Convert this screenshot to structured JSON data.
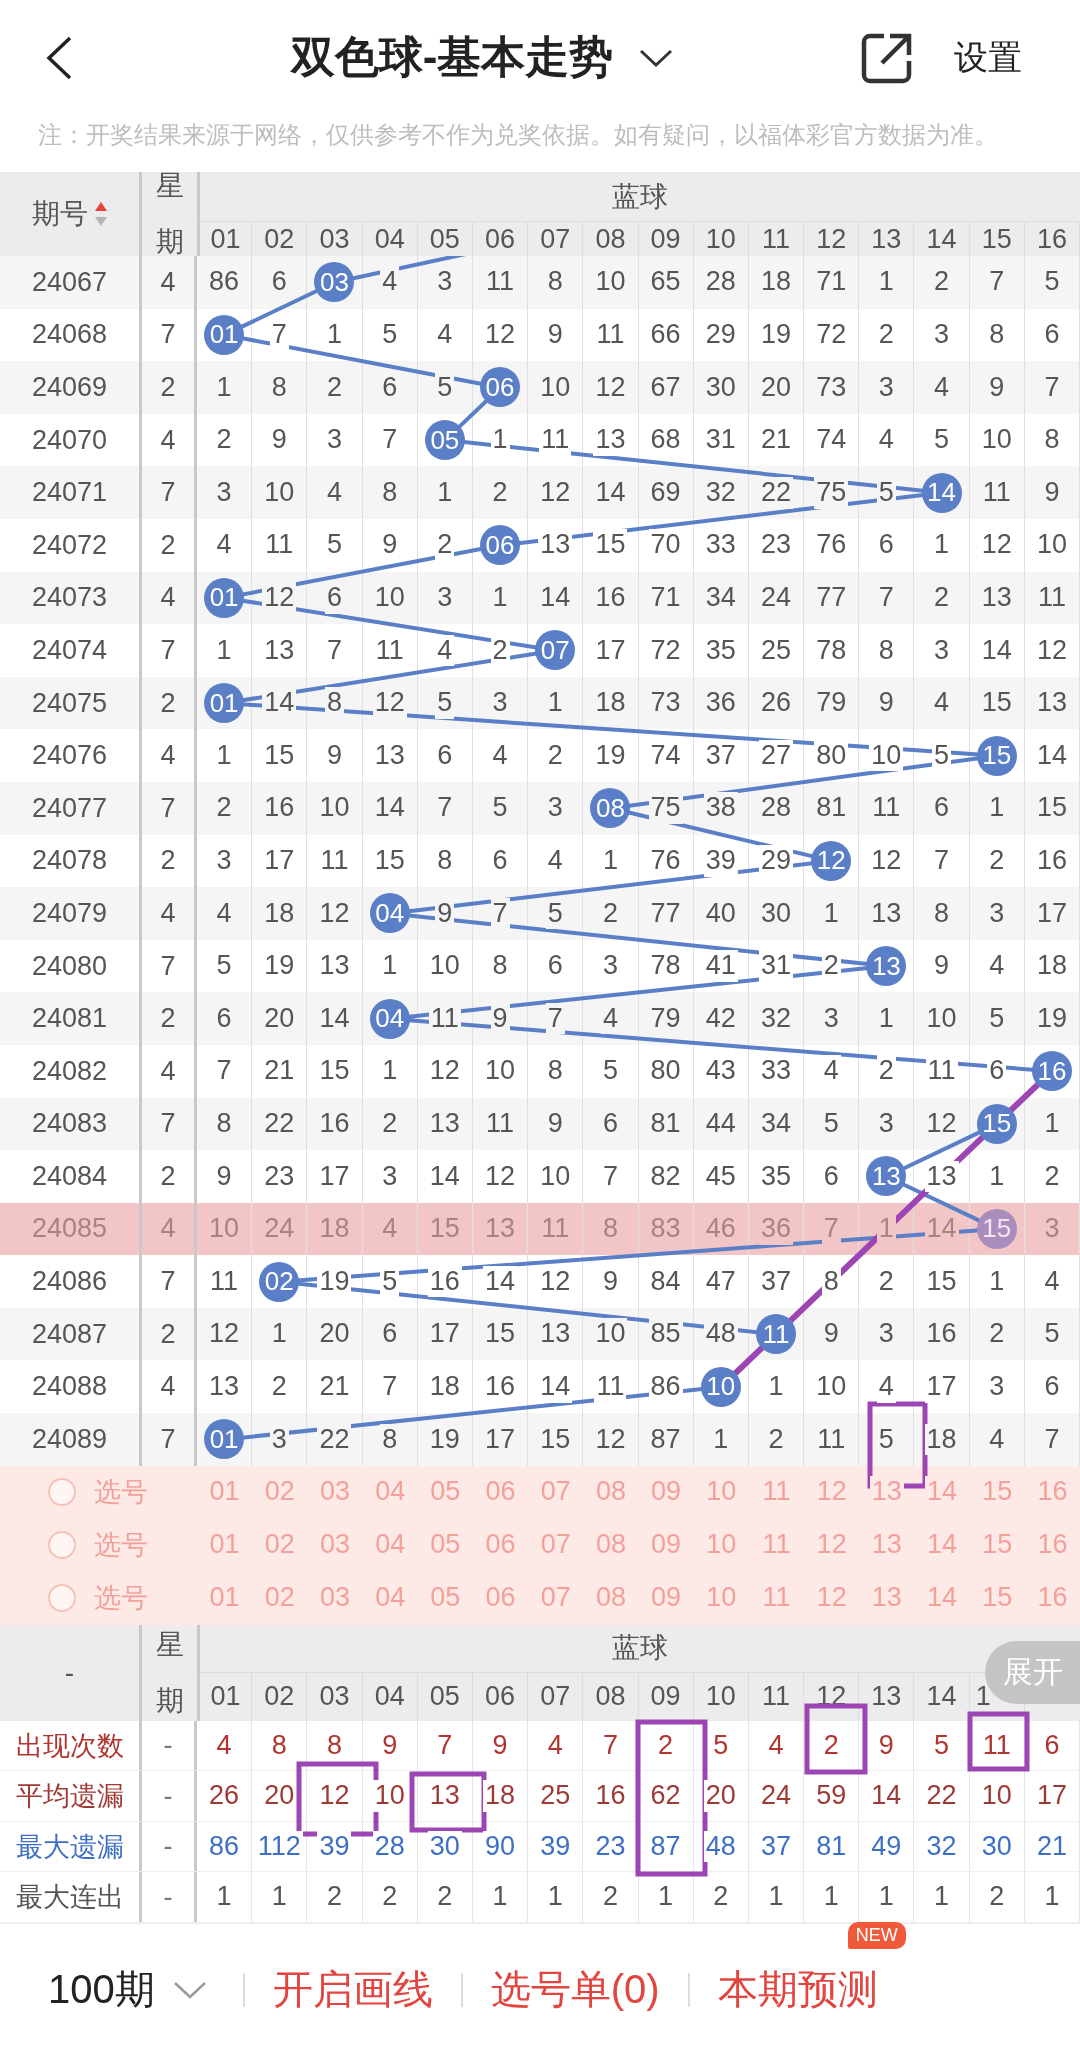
{
  "top_bar": {
    "title": "双色球-基本走势",
    "settings": "设置"
  },
  "note": "注：开奖结果来源于网络，仅供参考不作为兑奖依据。如有疑问，以福体彩官方数据为准。",
  "header": {
    "period_label": "期号",
    "sort_ascending": true,
    "weekday_label": "星期",
    "group_label": "蓝球",
    "columns": [
      "01",
      "02",
      "03",
      "04",
      "05",
      "06",
      "07",
      "08",
      "09",
      "10",
      "11",
      "12",
      "13",
      "14",
      "15",
      "16"
    ]
  },
  "rows": [
    {
      "period": "24067",
      "weekday": "4",
      "selected": false,
      "before": [
        "86",
        "6"
      ],
      "ball": "03",
      "after": [
        "4",
        "3",
        "11",
        "8",
        "10",
        "65",
        "28",
        "18",
        "71",
        "1",
        "2",
        "7",
        "5"
      ]
    },
    {
      "period": "24068",
      "weekday": "7",
      "selected": false,
      "ball": "01",
      "after": [
        "7",
        "1",
        "5",
        "4",
        "12",
        "9",
        "11",
        "66",
        "29",
        "19",
        "72",
        "2",
        "3",
        "8",
        "6"
      ]
    },
    {
      "period": "24069",
      "weekday": "2",
      "selected": false,
      "before": [
        "1",
        "8",
        "2",
        "6",
        "5"
      ],
      "ball": "06",
      "after": [
        "10",
        "12",
        "67",
        "30",
        "20",
        "73",
        "3",
        "4",
        "9",
        "7"
      ]
    },
    {
      "period": "24070",
      "weekday": "4",
      "selected": false,
      "before": [
        "2",
        "9",
        "3",
        "7"
      ],
      "ball": "05",
      "after": [
        "1",
        "11",
        "13",
        "68",
        "31",
        "21",
        "74",
        "4",
        "5",
        "10",
        "8"
      ]
    },
    {
      "period": "24071",
      "weekday": "7",
      "selected": false,
      "before": [
        "3",
        "10",
        "4",
        "8",
        "1",
        "2",
        "12",
        "14",
        "69",
        "32",
        "22",
        "75",
        "5"
      ],
      "ball": "14",
      "after": [
        "11",
        "9"
      ]
    },
    {
      "period": "24072",
      "weekday": "2",
      "selected": false,
      "before": [
        "4",
        "11",
        "5",
        "9",
        "2"
      ],
      "ball": "06",
      "after": [
        "13",
        "15",
        "70",
        "33",
        "23",
        "76",
        "6",
        "1",
        "12",
        "10"
      ]
    },
    {
      "period": "24073",
      "weekday": "4",
      "selected": false,
      "ball": "01",
      "after": [
        "12",
        "6",
        "10",
        "3",
        "1",
        "14",
        "16",
        "71",
        "34",
        "24",
        "77",
        "7",
        "2",
        "13",
        "11"
      ]
    },
    {
      "period": "24074",
      "weekday": "7",
      "selected": false,
      "before": [
        "1",
        "13",
        "7",
        "11",
        "4",
        "2"
      ],
      "ball": "07",
      "after": [
        "17",
        "72",
        "35",
        "25",
        "78",
        "8",
        "3",
        "14",
        "12"
      ]
    },
    {
      "period": "24075",
      "weekday": "2",
      "selected": false,
      "ball": "01",
      "after": [
        "14",
        "8",
        "12",
        "5",
        "3",
        "1",
        "18",
        "73",
        "36",
        "26",
        "79",
        "9",
        "4",
        "15",
        "13"
      ]
    },
    {
      "period": "24076",
      "weekday": "4",
      "selected": false,
      "before": [
        "1",
        "15",
        "9",
        "13",
        "6",
        "4",
        "2",
        "19",
        "74",
        "37",
        "27",
        "80",
        "10",
        "5"
      ],
      "ball": "15",
      "after": [
        "14"
      ]
    },
    {
      "period": "24077",
      "weekday": "7",
      "selected": false,
      "before": [
        "2",
        "16",
        "10",
        "14",
        "7",
        "5",
        "3"
      ],
      "ball": "08",
      "after": [
        "75",
        "38",
        "28",
        "81",
        "11",
        "6",
        "1",
        "15"
      ]
    },
    {
      "period": "24078",
      "weekday": "2",
      "selected": false,
      "before": [
        "3",
        "17",
        "11",
        "15",
        "8",
        "6",
        "4",
        "1",
        "76",
        "39",
        "29"
      ],
      "ball": "12",
      "after": [
        "12",
        "7",
        "2",
        "16"
      ]
    },
    {
      "period": "24079",
      "weekday": "4",
      "selected": false,
      "before": [
        "4",
        "18",
        "12"
      ],
      "ball": "04",
      "after": [
        "9",
        "7",
        "5",
        "2",
        "77",
        "40",
        "30",
        "1",
        "13",
        "8",
        "3",
        "17"
      ]
    },
    {
      "period": "24080",
      "weekday": "7",
      "selected": false,
      "before": [
        "5",
        "19",
        "13",
        "1",
        "10",
        "8",
        "6",
        "3",
        "78",
        "41",
        "31",
        "2"
      ],
      "ball": "13",
      "after": [
        "9",
        "4",
        "18"
      ]
    },
    {
      "period": "24081",
      "weekday": "2",
      "selected": false,
      "before": [
        "6",
        "20",
        "14"
      ],
      "ball": "04",
      "after": [
        "11",
        "9",
        "7",
        "4",
        "79",
        "42",
        "32",
        "3",
        "1",
        "10",
        "5",
        "19"
      ]
    },
    {
      "period": "24082",
      "weekday": "4",
      "selected": false,
      "before": [
        "7",
        "21",
        "15",
        "1",
        "12",
        "10",
        "8",
        "5",
        "80",
        "43",
        "33",
        "4",
        "2",
        "11",
        "6"
      ],
      "ball": "16"
    },
    {
      "period": "24083",
      "weekday": "7",
      "selected": false,
      "before": [
        "8",
        "22",
        "16",
        "2",
        "13",
        "11",
        "9",
        "6",
        "81",
        "44",
        "34",
        "5",
        "3",
        "12"
      ],
      "ball": "15",
      "after": [
        "1"
      ]
    },
    {
      "period": "24084",
      "weekday": "2",
      "selected": false,
      "before": [
        "9",
        "23",
        "17",
        "3",
        "14",
        "12",
        "10",
        "7",
        "82",
        "45",
        "35",
        "6"
      ],
      "ball": "13",
      "after": [
        "13",
        "1",
        "2"
      ]
    },
    {
      "period": "24085",
      "weekday": "4",
      "selected": true,
      "before": [
        "10",
        "24",
        "18",
        "4",
        "15",
        "13",
        "11",
        "8",
        "83",
        "46",
        "36",
        "7",
        "1",
        "14"
      ],
      "ball": "15",
      "after": [
        "3"
      ]
    },
    {
      "period": "24086",
      "weekday": "7",
      "selected": false,
      "before": [
        "11"
      ],
      "ball": "02",
      "after": [
        "19",
        "5",
        "16",
        "14",
        "12",
        "9",
        "84",
        "47",
        "37",
        "8",
        "2",
        "15",
        "1",
        "4"
      ]
    },
    {
      "period": "24087",
      "weekday": "2",
      "selected": false,
      "before": [
        "12",
        "1",
        "20",
        "6",
        "17",
        "15",
        "13",
        "10",
        "85",
        "48"
      ],
      "ball": "11",
      "after": [
        "9",
        "3",
        "16",
        "2",
        "5"
      ]
    },
    {
      "period": "24088",
      "weekday": "4",
      "selected": false,
      "before": [
        "13",
        "2",
        "21",
        "7",
        "18",
        "16",
        "14",
        "11",
        "86"
      ],
      "ball": "10",
      "after": [
        "1",
        "10",
        "4",
        "17",
        "3",
        "6"
      ]
    },
    {
      "period": "24089",
      "weekday": "7",
      "selected": false,
      "ball": "01",
      "after": [
        "3",
        "22",
        "8",
        "19",
        "17",
        "15",
        "12",
        "87",
        "1",
        "2",
        "11",
        "5",
        "18",
        "4",
        "7"
      ]
    }
  ],
  "pick_rows": [
    {
      "label": "选号",
      "checked": false,
      "numbers": [
        "01",
        "02",
        "03",
        "04",
        "05",
        "06",
        "07",
        "08",
        "09",
        "10",
        "11",
        "12",
        "13",
        "14",
        "15",
        "16"
      ]
    },
    {
      "label": "选号",
      "checked": false,
      "numbers": [
        "01",
        "02",
        "03",
        "04",
        "05",
        "06",
        "07",
        "08",
        "09",
        "10",
        "11",
        "12",
        "13",
        "14",
        "15",
        "16"
      ]
    },
    {
      "label": "选号",
      "checked": false,
      "numbers": [
        "01",
        "02",
        "03",
        "04",
        "05",
        "06",
        "07",
        "08",
        "09",
        "10",
        "11",
        "12",
        "13",
        "14",
        "15",
        "16"
      ]
    }
  ],
  "stats_header": {
    "period_label": "-",
    "weekday_label": "星期",
    "group_label": "蓝球",
    "columns": [
      "01",
      "02",
      "03",
      "04",
      "05",
      "06",
      "07",
      "08",
      "09",
      "10",
      "11",
      "12",
      "13",
      "14",
      "1"
    ],
    "expand": "展开"
  },
  "stats": [
    {
      "kind": "count",
      "label": "出现次数",
      "weekday": "-",
      "values": [
        "4",
        "8",
        "8",
        "9",
        "7",
        "9",
        "4",
        "7",
        "2",
        "5",
        "4",
        "2",
        "9",
        "5",
        "11",
        "6"
      ]
    },
    {
      "kind": "average_miss",
      "label": "平均遗漏",
      "weekday": "-",
      "values": [
        "26",
        "20",
        "12",
        "10",
        "13",
        "18",
        "25",
        "16",
        "62",
        "20",
        "24",
        "59",
        "14",
        "22",
        "10",
        "17"
      ]
    },
    {
      "kind": "max_miss",
      "label": "最大遗漏",
      "weekday": "-",
      "values": [
        "86",
        "112",
        "39",
        "28",
        "30",
        "90",
        "39",
        "23",
        "87",
        "48",
        "37",
        "81",
        "49",
        "32",
        "30",
        "21"
      ]
    },
    {
      "kind": "max_streak",
      "label": "最大连出",
      "weekday": "-",
      "values": [
        "1",
        "1",
        "2",
        "2",
        "2",
        "1",
        "1",
        "2",
        "1",
        "2",
        "1",
        "1",
        "1",
        "1",
        "2",
        "1"
      ]
    }
  ],
  "bottom_bar": {
    "period_select": "100期",
    "actions": [
      {
        "label": "开启画线"
      },
      {
        "label": "选号单(0)"
      },
      {
        "label": "本期预测",
        "badge": "NEW"
      }
    ]
  }
}
